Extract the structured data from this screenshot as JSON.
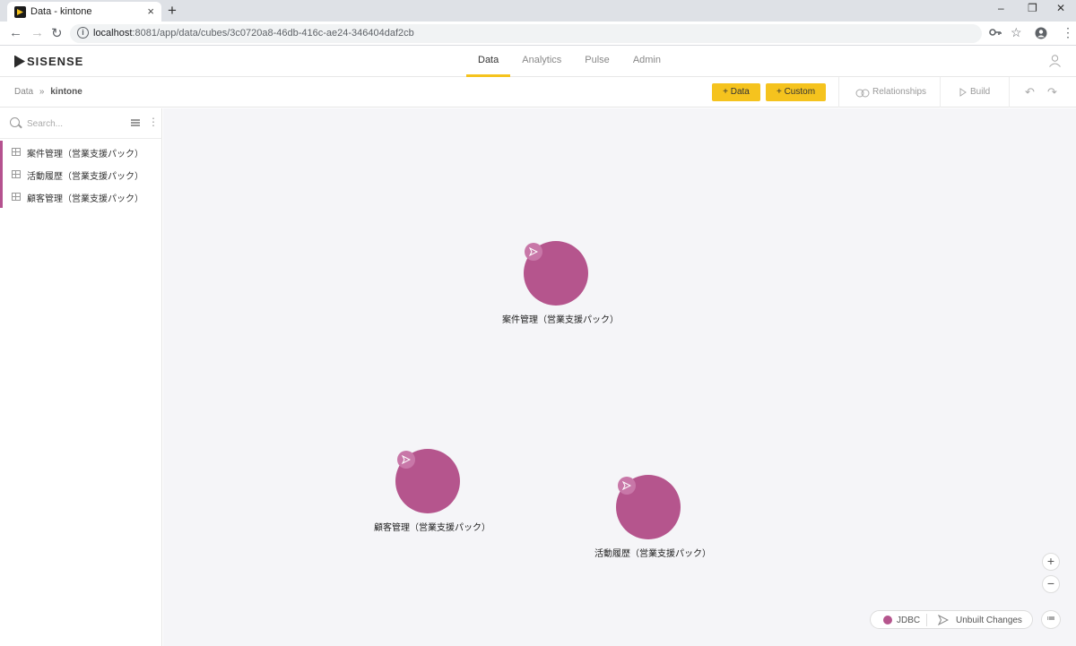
{
  "browser": {
    "tab_title": "Data - kintone",
    "url_host": "localhost",
    "url_rest": ":8081/app/data/cubes/3c0720a8-46db-416c-ae24-346404daf2cb"
  },
  "app": {
    "logo_text": "SISENSE",
    "nav": [
      {
        "label": "Data",
        "active": true
      },
      {
        "label": "Analytics",
        "active": false
      },
      {
        "label": "Pulse",
        "active": false
      },
      {
        "label": "Admin",
        "active": false
      }
    ]
  },
  "toolbar": {
    "breadcrumb_root": "Data",
    "breadcrumb_sep": "»",
    "breadcrumb_current": "kintone",
    "add_data_label": "+ Data",
    "add_custom_label": "+ Custom",
    "relationships_label": "Relationships",
    "build_label": "Build"
  },
  "sidebar": {
    "search_placeholder": "Search...",
    "items": [
      {
        "label": "案件管理（営業支援パック）"
      },
      {
        "label": "活動履歴（営業支援パック）"
      },
      {
        "label": "顧客管理（営業支援パック）"
      }
    ]
  },
  "canvas": {
    "nodes": [
      {
        "label": "案件管理（営業支援パック）"
      },
      {
        "label": "顧客管理（営業支援パック）"
      },
      {
        "label": "活動履歴（営業支援パック）"
      }
    ],
    "node_color": "#b5558d",
    "legend": {
      "jdbc_label": "JDBC",
      "unbuilt_label": "Unbuilt Changes"
    }
  },
  "colors": {
    "accent": "#f5c31e",
    "datasource": "#b5558d"
  }
}
